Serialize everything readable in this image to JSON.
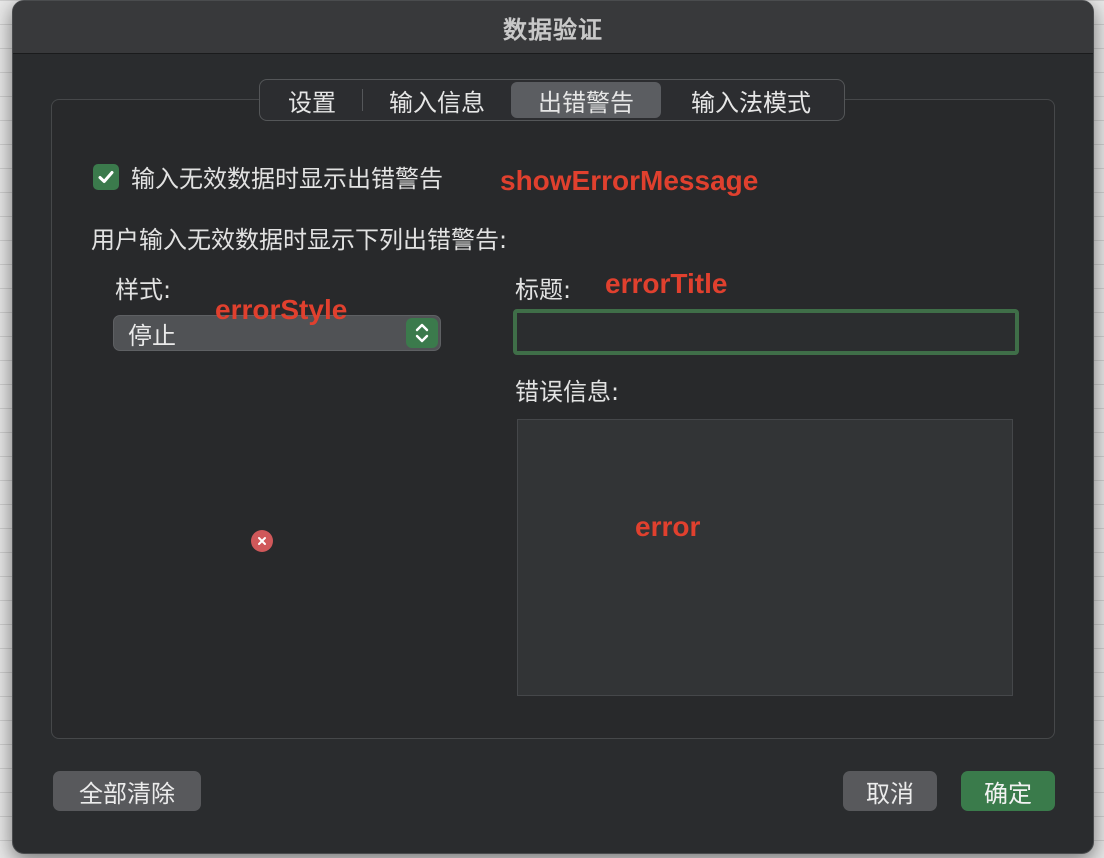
{
  "window": {
    "title": "数据验证"
  },
  "tabs": [
    {
      "label": "设置"
    },
    {
      "label": "输入信息"
    },
    {
      "label": "出错警告",
      "selected": true
    },
    {
      "label": "输入法模式"
    }
  ],
  "show_error": {
    "label": "输入无效数据时显示出错警告",
    "checked": true,
    "annotation": "showErrorMessage"
  },
  "instruction": "用户输入无效数据时显示下列出错警告:",
  "style": {
    "label": "样式:",
    "value": "停止",
    "annotation": "errorStyle",
    "icon": "stop-error-icon"
  },
  "title_field": {
    "label": "标题:",
    "value": "",
    "annotation": "errorTitle"
  },
  "message_field": {
    "label": "错误信息:",
    "value": "",
    "annotation": "error"
  },
  "buttons": {
    "clear_all": "全部清除",
    "cancel": "取消",
    "ok": "确定"
  },
  "colors": {
    "accent": "#3a7b4b",
    "annotation": "#e0402e",
    "dialog_bg": "#2a2c2e"
  }
}
